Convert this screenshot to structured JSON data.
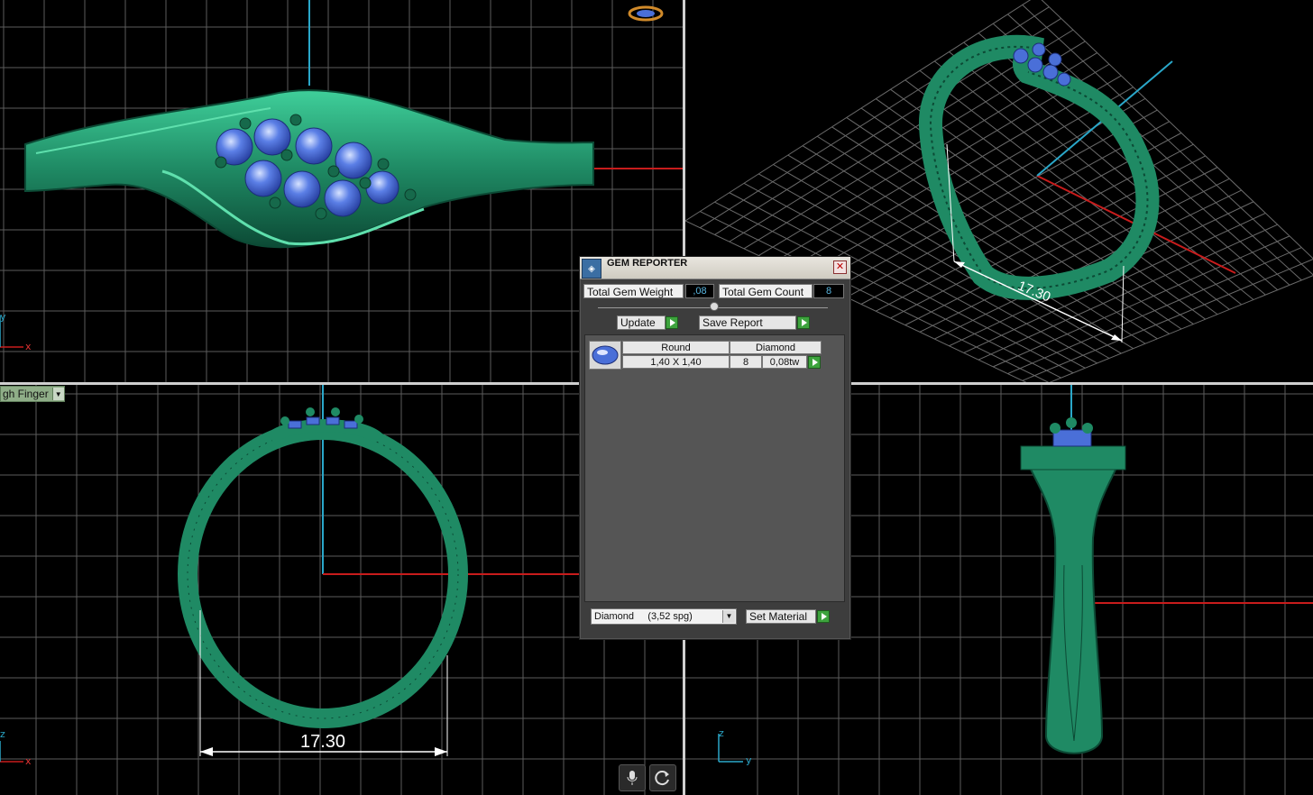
{
  "viewports": {
    "top": {
      "axis_x": "x",
      "axis_y": "y"
    },
    "front": {
      "axis_x": "x",
      "axis_z": "z",
      "dimension": "17.30",
      "finger_dropdown": "gh Finger"
    },
    "side": {
      "axis_y": "y",
      "axis_z": "z"
    },
    "perspective": {
      "dimension": "17.30"
    }
  },
  "gem_reporter": {
    "title": "GEM REPORTER",
    "close_symbol": "✕",
    "total_weight_label": "Total Gem Weight",
    "total_weight_value": ",08",
    "total_count_label": "Total Gem Count",
    "total_count_value": "8",
    "update_label": "Update",
    "save_report_label": "Save Report",
    "table": {
      "shape_header": "Round",
      "material_header": "Diamond",
      "rows": [
        {
          "size": "1,40 X 1,40",
          "count": "8",
          "weight": "0,08tw"
        }
      ]
    },
    "material_select": "Diamond     (3,52 spg)",
    "set_material_label": "Set Material"
  },
  "toolbar": {
    "mic_icon": "microphone-icon",
    "refresh_icon": "refresh-icon"
  },
  "colors": {
    "ring": "#1f8a64",
    "gem": "#4a6fd8",
    "grid": "#6b6b6b",
    "axis_red": "#c81c1c",
    "axis_blue": "#2aa7c9"
  }
}
